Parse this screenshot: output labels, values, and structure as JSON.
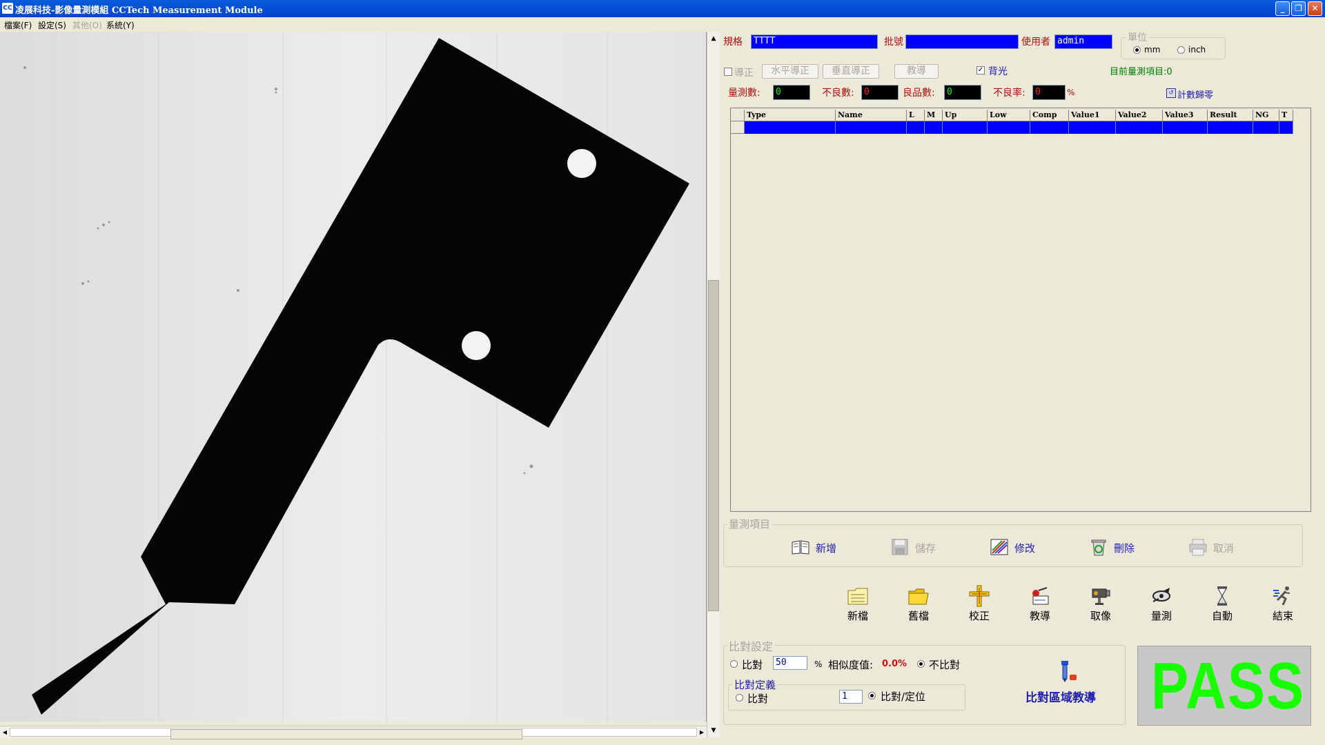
{
  "window": {
    "title": "凌展科技-影像量測模組 CCTech Measurement Module",
    "icon_text": "CC",
    "btn_min": "_",
    "btn_max": "❐",
    "btn_close": "✕"
  },
  "menu": [
    {
      "label": "檔案(F)",
      "enabled": true
    },
    {
      "label": "設定(S)",
      "enabled": true
    },
    {
      "label": "其他(O)",
      "enabled": false
    },
    {
      "label": "系統(Y)",
      "enabled": true
    }
  ],
  "header": {
    "spec_label": "規格",
    "spec_value": "TTTT",
    "batch_label": "批號",
    "batch_value": "",
    "user_label": "使用者",
    "user_value": "admin",
    "unit_group": "單位",
    "unit_mm": "mm",
    "unit_inch": "inch",
    "unit_selected": "mm"
  },
  "calibration": {
    "calib_check": "導正",
    "h_calib": "水平導正",
    "v_calib": "垂直導正",
    "teach": "教導",
    "backlight": "背光",
    "current_items": "目前量測項目:0"
  },
  "counts": {
    "measure_label": "量測數:",
    "measure_value": "0",
    "bad_label": "不良數:",
    "bad_value": "0",
    "good_label": "良品數:",
    "good_value": "0",
    "bad_rate_label": "不良率:",
    "bad_rate_value": "0",
    "percent": "%",
    "reset_counter": "計數歸零"
  },
  "table": {
    "columns": [
      "Type",
      "Name",
      "L",
      "M",
      "Up",
      "Low",
      "Comp",
      "Value1",
      "Value2",
      "Value3",
      "Result",
      "NG",
      "T"
    ]
  },
  "measure_items": {
    "group": "量測項目",
    "add": "新增",
    "save": "儲存",
    "modify": "修改",
    "delete": "刪除",
    "cancel": "取消"
  },
  "toolbar": {
    "new_file": "新檔",
    "old_file": "舊檔",
    "calibrate": "校正",
    "teach": "教導",
    "capture": "取像",
    "measure": "量測",
    "auto": "自動",
    "exit": "結束"
  },
  "compare": {
    "group": "比對設定",
    "compare_radio": "比對",
    "threshold": "50",
    "percent": "%",
    "similarity_label": "相似度值:",
    "similarity_value": "0.0%",
    "no_compare": "不比對",
    "define_group": "比對定義",
    "define_compare": "比對",
    "define_index": "1",
    "compare_locate": "比對/定位",
    "region_teach": "比對區域教導"
  },
  "result": {
    "status": "PASS",
    "color": "#18ff00"
  }
}
